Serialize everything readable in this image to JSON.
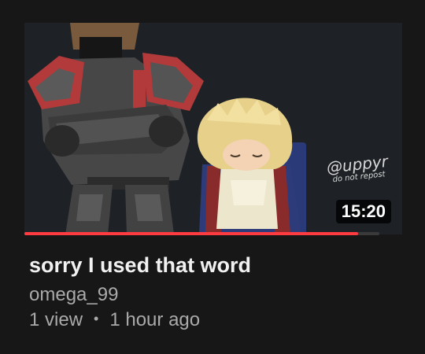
{
  "video": {
    "title": "sorry I used that word",
    "channel": "omega_99",
    "views": "1 view",
    "separator": "•",
    "age": "1 hour ago",
    "duration": "15:20",
    "progress_fraction": 0.94,
    "progress_color": "#ff3b42"
  },
  "thumbnail": {
    "watermark_handle": "@uppyr",
    "watermark_note": "do not repost"
  }
}
